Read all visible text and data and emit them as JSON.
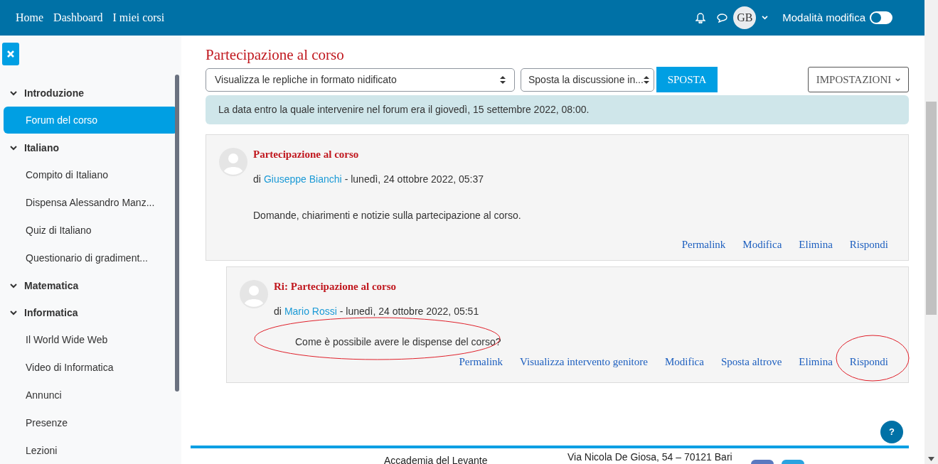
{
  "navbar": {
    "links": [
      "Home",
      "Dashboard",
      "I miei corsi"
    ],
    "avatar_initials": "GB",
    "edit_mode": {
      "label": "Modalità modifica",
      "on": false
    }
  },
  "sidebar": {
    "sections": [
      {
        "label": "Introduzione",
        "expanded": true,
        "children": [
          {
            "label": "Forum del corso",
            "selected": true
          }
        ]
      },
      {
        "label": "Italiano",
        "expanded": true,
        "children": [
          {
            "label": "Compito di Italiano",
            "selected": false
          },
          {
            "label": "Dispensa Alessandro Manz...",
            "selected": false
          },
          {
            "label": "Quiz di Italiano",
            "selected": false
          },
          {
            "label": "Questionario di gradiment...",
            "selected": false
          }
        ]
      },
      {
        "label": "Matematica",
        "expanded": true
      },
      {
        "label": "Informatica",
        "expanded": true,
        "children": [
          {
            "label": "Il World Wide Web",
            "selected": false
          },
          {
            "label": "Video di Informatica",
            "selected": false
          },
          {
            "label": "Annunci",
            "selected": false
          },
          {
            "label": "Presenze",
            "selected": false
          },
          {
            "label": "Lezioni",
            "selected": false
          }
        ]
      }
    ]
  },
  "page_title": "Partecipazione al corso",
  "toolbar": {
    "display_select": "Visualizza le repliche in formato nidificato",
    "move_select": "Sposta la discussione in...",
    "move_button": "SPOSTA",
    "settings_button": "IMPOSTAZIONI"
  },
  "notice": "La data entro la quale intervenire nel forum era il giovedì, 15 settembre 2022, 08:00.",
  "posts": [
    {
      "title": "Partecipazione al corso",
      "by": "di",
      "author": "Giuseppe Bianchi",
      "date": "- lunedì, 24 ottobre 2022, 05:37",
      "body": "Domande, chiarimenti e notizie sulla partecipazione al corso.",
      "actions": [
        "Permalink",
        "Modifica",
        "Elimina",
        "Rispondi"
      ],
      "is_reply": false
    },
    {
      "title": "Ri: Partecipazione al corso",
      "by": "di",
      "author": "Mario Rossi",
      "date": "- lunedì, 24 ottobre 2022, 05:51",
      "body": "Come è possibile avere le dispense del corso?",
      "actions": [
        "Permalink",
        "Visualizza intervento genitore",
        "Modifica",
        "Sposta altrove",
        "Elimina",
        "Rispondi"
      ],
      "is_reply": true
    }
  ],
  "help_button": "?",
  "footer": {
    "name": "Accademia del Levante",
    "address": "Via Nicola De Giosa, 54 – 70121 Bari"
  }
}
